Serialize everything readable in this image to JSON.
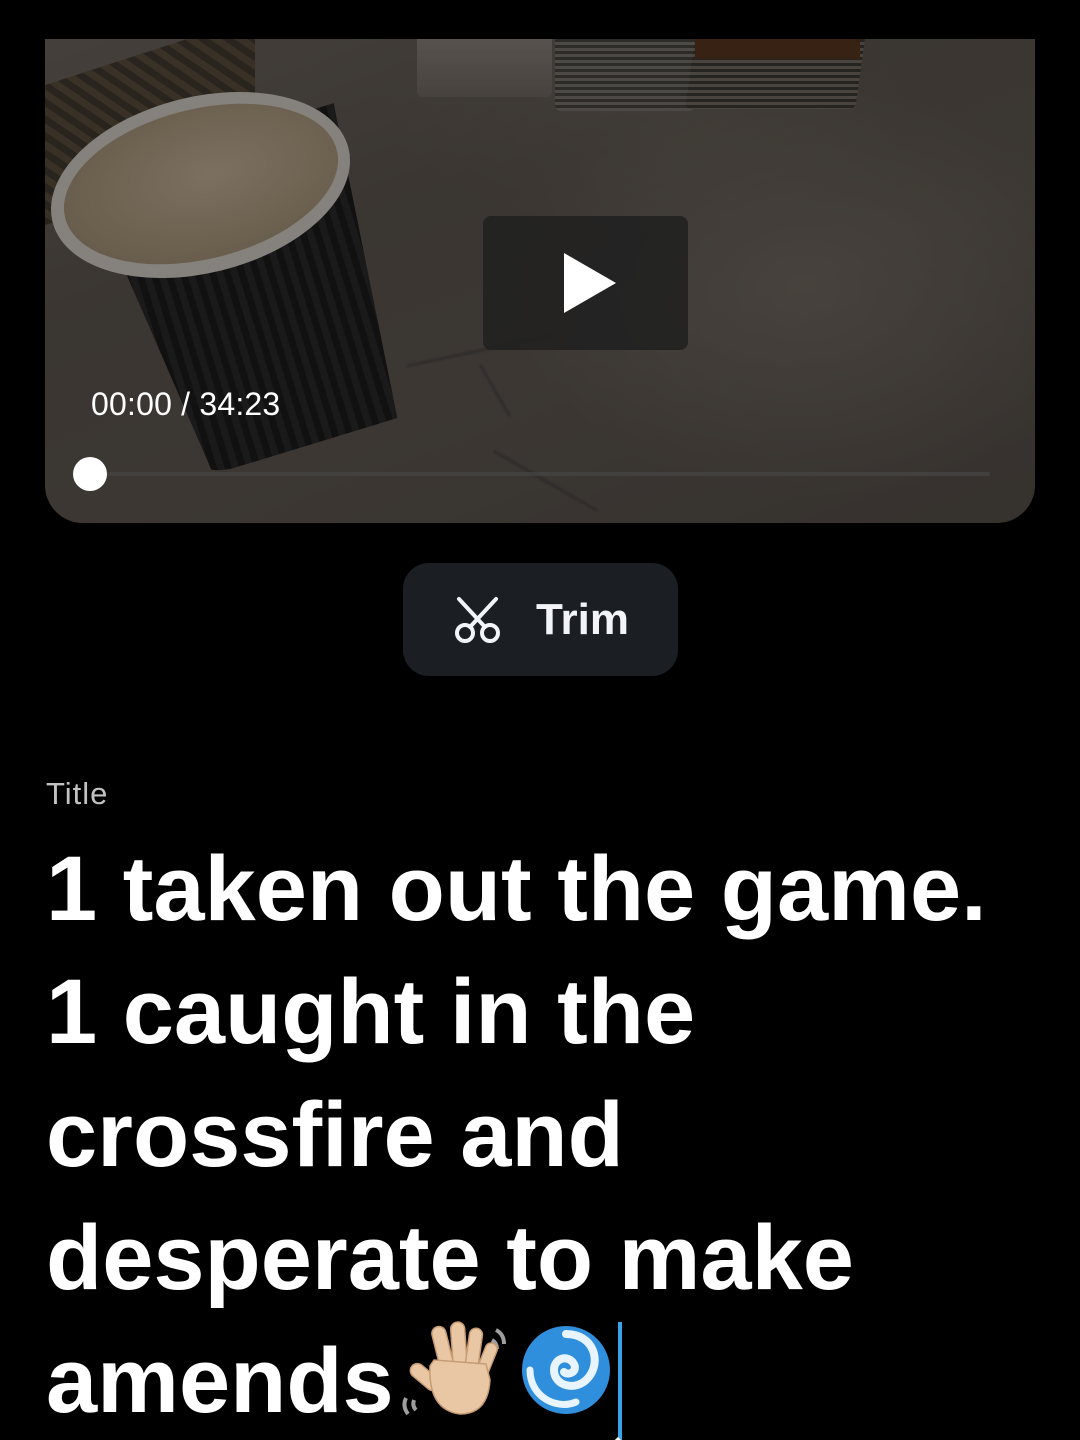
{
  "video": {
    "time_readout": "00:00 / 34:23",
    "current_time": "00:00",
    "duration": "34:23",
    "progress_fraction": 0.0
  },
  "trim": {
    "label": "Trim"
  },
  "title_field": {
    "label": "Title",
    "value": "1 taken out the game. 1 caught in the crossfire and desperate to make amends",
    "emojis": [
      "waving-hand-icon",
      "cyclone-icon"
    ]
  },
  "colors": {
    "background": "#000000",
    "trim_button_bg": "#1b1f24",
    "caret": "#3aa3e8"
  }
}
